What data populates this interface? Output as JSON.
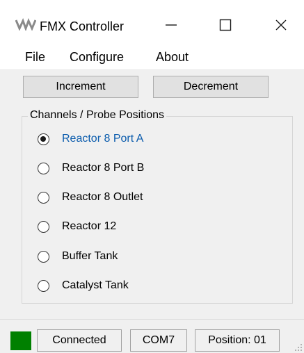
{
  "window": {
    "title": "FMX Controller",
    "icon": "fmx-logo-icon"
  },
  "menu": {
    "items": [
      {
        "label": "File"
      },
      {
        "label": "Configure"
      },
      {
        "label": "About"
      }
    ]
  },
  "toolbar": {
    "increment_label": "Increment",
    "decrement_label": "Decrement"
  },
  "channels": {
    "group_label": "Channels / Probe Positions",
    "selected_index": 0,
    "options": [
      {
        "label": "Reactor 8 Port A",
        "checked": true
      },
      {
        "label": "Reactor 8 Port B",
        "checked": false
      },
      {
        "label": "Reactor 8 Outlet",
        "checked": false
      },
      {
        "label": "Reactor 12",
        "checked": false
      },
      {
        "label": "Buffer Tank",
        "checked": false
      },
      {
        "label": "Catalyst Tank",
        "checked": false
      }
    ]
  },
  "status": {
    "indicator_color": "#008000",
    "connection": "Connected",
    "port": "COM7",
    "position": "Position: 01"
  },
  "colors": {
    "selected_text": "#0b5cad",
    "window_bg": "#f0f0f0",
    "button_bg": "#e1e1e1"
  }
}
